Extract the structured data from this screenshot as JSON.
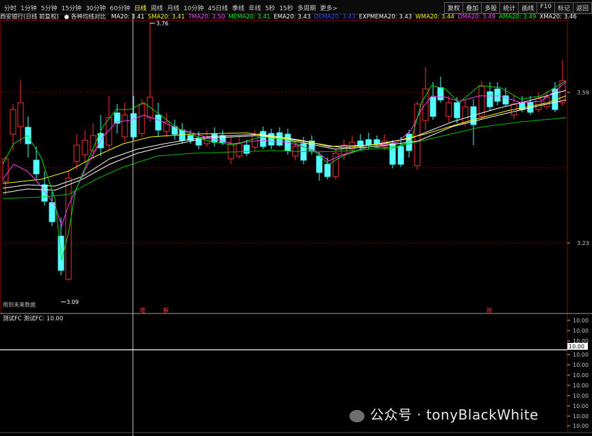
{
  "toolbar": {
    "periods": [
      "分时",
      "1分钟",
      "5分钟",
      "15分钟",
      "30分钟",
      "60分钟",
      "日线",
      "周线",
      "月线",
      "10分钟",
      "45日线",
      "季线",
      "年线",
      "5秒",
      "15秒",
      "多周期",
      "更多>"
    ],
    "right_buttons": [
      "复权",
      "叠加",
      "多股",
      "统计",
      "画线",
      "F10",
      "标记",
      "返回"
    ]
  },
  "info": {
    "stock": "西安银行(日线 前复权)",
    "indicator": "● 各种均线对比",
    "items": [
      {
        "text": "MA20: 3.41",
        "color": "#ffffff"
      },
      {
        "text": "SMA20: 3.41",
        "color": "#ffff00"
      },
      {
        "text": "TMA20: 3.50",
        "color": "#ff40ff"
      },
      {
        "text": "MEMA20: 3.41",
        "color": "#00ff00"
      },
      {
        "text": "EMA20: 3.43",
        "color": "#ffffff"
      },
      {
        "text": "DEMA20: 3.43",
        "color": "#3050ff"
      },
      {
        "text": "EXPMEMA20: 3.43",
        "color": "#ffffff"
      },
      {
        "text": "WMA20: 3.44",
        "color": "#ffff00"
      },
      {
        "text": "DMA20: 3.49",
        "color": "#ff40ff"
      },
      {
        "text": "AMA20: 3.49",
        "color": "#00ff00"
      },
      {
        "text": "XMA20: 3.46",
        "color": "#ffffff"
      }
    ]
  },
  "main_chart": {
    "y_ticks": [
      "3.59",
      "3.23"
    ],
    "high_label": "3.76",
    "low_label": "3.09",
    "future_data_note": "用到未来数据",
    "markers": [
      "增",
      "解",
      "财"
    ]
  },
  "sub_chart": {
    "title": "测试FC 测试FC: 10.00",
    "y_ticks": [
      "10.00",
      "10.00",
      "10.00",
      "10.00",
      "10.00",
      "10.00",
      "10.00",
      "10.00",
      "10.00",
      "10.00",
      "10.00"
    ],
    "current_value": "10.00"
  },
  "watermark": "公众号 · tonyBlackWhite",
  "colors": {
    "up": "#ff3232",
    "down": "#54ffff",
    "grid": "#8b0000",
    "ma_white": "#ffffff",
    "ma_yellow": "#ffff00",
    "ma_magenta": "#ff40ff",
    "ma_green": "#00c000"
  }
}
